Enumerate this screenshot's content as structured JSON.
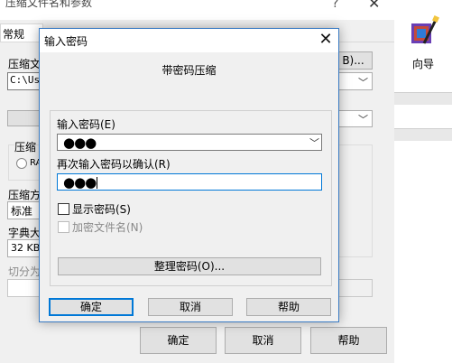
{
  "background_dialog": {
    "title": "压缩文件名和参数",
    "help_glyph": "?",
    "close_glyph": "✕",
    "tab_general": "常规",
    "archive_label": "压缩文",
    "path_value": "C:\\Use",
    "browse_button": "B)...",
    "group_format_label": "压缩",
    "radio_label": "RA",
    "method_label": "压缩方",
    "method_value": "标准",
    "dict_label": "字典大",
    "dict_value": "32 KB",
    "split_label": "切分为",
    "ok_button": "确定",
    "cancel_button": "取消",
    "help_button": "帮助"
  },
  "right_panel": {
    "wizard_label": "向导"
  },
  "password_dialog": {
    "title": "输入密码",
    "close_glyph": "✕",
    "heading": "带密码压缩",
    "enter_password_label": "输入密码(E)",
    "password_mask": "●●●",
    "reenter_label": "再次输入密码以确认(R)",
    "reenter_mask": "●●●",
    "show_password_label": "显示密码(S)",
    "show_password_checked": false,
    "encrypt_names_label": "加密文件名(N)",
    "encrypt_names_enabled": false,
    "organize_button": "整理密码(O)...",
    "ok_button": "确定",
    "cancel_button": "取消",
    "help_button": "帮助"
  },
  "colors": {
    "focus_blue": "#0078d7",
    "dialog_border": "#3b7cc4"
  }
}
